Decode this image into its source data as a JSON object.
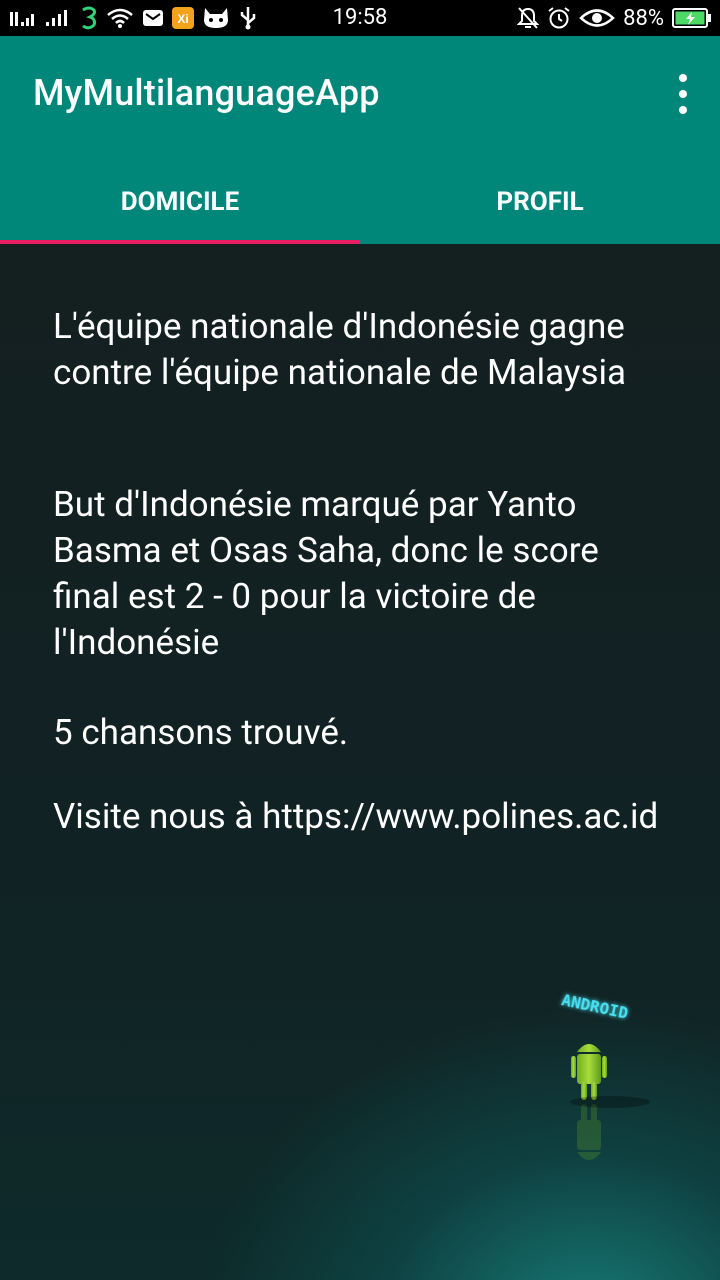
{
  "status_bar": {
    "time": "19:58",
    "battery_percent": "88%",
    "left_icons": [
      "signal-1-icon",
      "signal-2-icon",
      "network-3-icon",
      "wifi-icon",
      "mail-icon",
      "app-notification-icon",
      "cat-icon",
      "usb-icon"
    ],
    "right_icons": [
      "notifications-off-icon",
      "alarm-icon",
      "eye-icon",
      "battery-charging-icon"
    ]
  },
  "app_bar": {
    "title": "MyMultilanguageApp",
    "overflow_icon": "more-vert-icon",
    "color": "#01877a"
  },
  "tabs": [
    {
      "label": "DOMICILE",
      "selected": true
    },
    {
      "label": "PROFIL",
      "selected": false
    }
  ],
  "tab_indicator_color": "#e91e63",
  "content": {
    "paragraph_1": "L'équipe nationale d'Indonésie gagne contre l'équipe nationale de Malaysia",
    "paragraph_2": "But d'Indonésie marqué par Yanto Basma et Osas Saha, donc le score final est 2 - 0 pour la victoire de l'Indonésie",
    "paragraph_3": "5 chansons trouvé.",
    "paragraph_4": "Visite nous à https://www.polines.ac.id",
    "wallpaper_text": "ANDROID"
  }
}
